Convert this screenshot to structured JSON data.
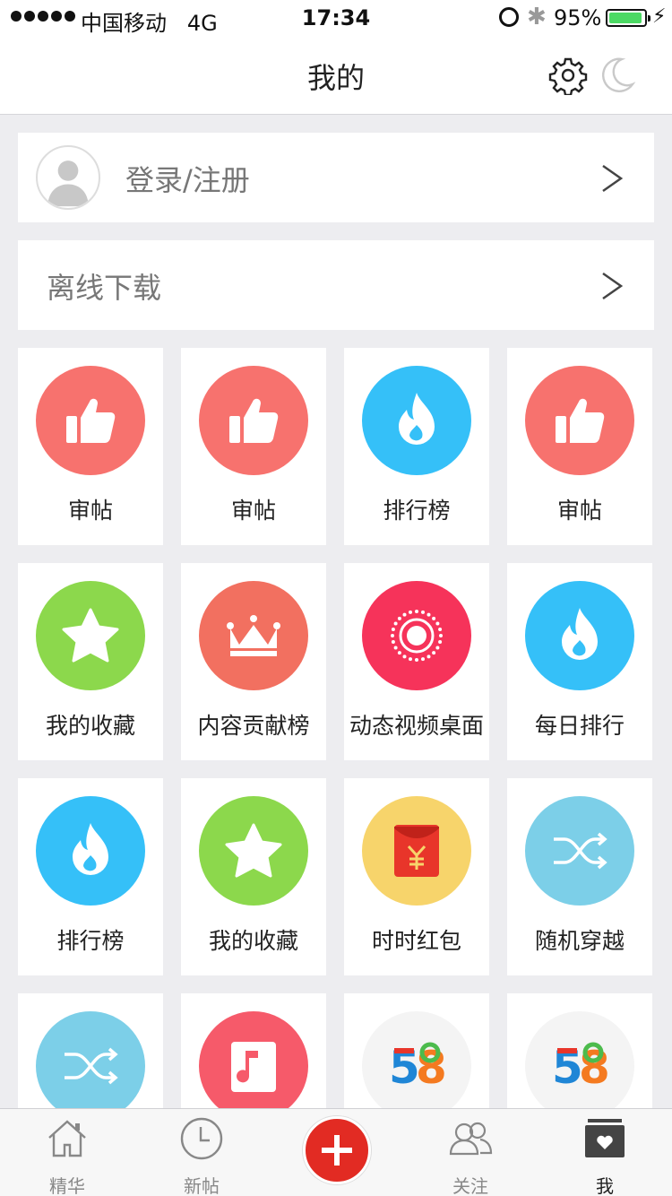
{
  "status_bar": {
    "carrier": "中国移动",
    "network": "4G",
    "time": "17:34",
    "battery": "95%",
    "battery_level": 0.95
  },
  "nav": {
    "title": "我的",
    "icons": [
      "gear-icon",
      "moon-icon"
    ]
  },
  "login": {
    "label": "登录/注册"
  },
  "offline": {
    "label": "离线下载"
  },
  "grid": {
    "items": [
      {
        "label": "审帖",
        "icon": "thumbs-up-icon",
        "color": "#f7726e"
      },
      {
        "label": "审帖",
        "icon": "thumbs-up-icon",
        "color": "#f7726e"
      },
      {
        "label": "排行榜",
        "icon": "flame-icon",
        "color": "#35c0f8"
      },
      {
        "label": "审帖",
        "icon": "thumbs-up-icon",
        "color": "#f7726e"
      },
      {
        "label": "我的收藏",
        "icon": "star-icon",
        "color": "#8cd84c"
      },
      {
        "label": "内容贡献榜",
        "icon": "crown-icon",
        "color": "#f27060"
      },
      {
        "label": "动态视频桌面",
        "icon": "live-dot-icon",
        "color": "#f6335a"
      },
      {
        "label": "每日排行",
        "icon": "flame-icon",
        "color": "#35c0f8"
      },
      {
        "label": "排行榜",
        "icon": "flame-icon",
        "color": "#35c0f8"
      },
      {
        "label": "我的收藏",
        "icon": "star-icon",
        "color": "#8cd84c"
      },
      {
        "label": "时时红包",
        "icon": "red-envelope-icon",
        "color": "#f7d46b"
      },
      {
        "label": "随机穿越",
        "icon": "shuffle-icon",
        "color": "#7ccfe8"
      },
      {
        "label": "",
        "icon": "shuffle-icon",
        "color": "#7ccfe8"
      },
      {
        "label": "",
        "icon": "music-note-icon",
        "color": "#f65a6a"
      },
      {
        "label": "",
        "icon": "logo-58-icon",
        "logo_text": "58",
        "color": "#f4f4f4"
      },
      {
        "label": "",
        "icon": "logo-58-icon",
        "logo_text": "58",
        "color": "#f4f4f4"
      }
    ]
  },
  "tabs": [
    {
      "label": "精华",
      "icon": "home-icon"
    },
    {
      "label": "新帖",
      "icon": "clock-icon"
    },
    {
      "label": "",
      "icon": "plus-icon"
    },
    {
      "label": "关注",
      "icon": "friends-icon"
    },
    {
      "label": "我",
      "icon": "profile-box-icon",
      "active": true
    }
  ]
}
